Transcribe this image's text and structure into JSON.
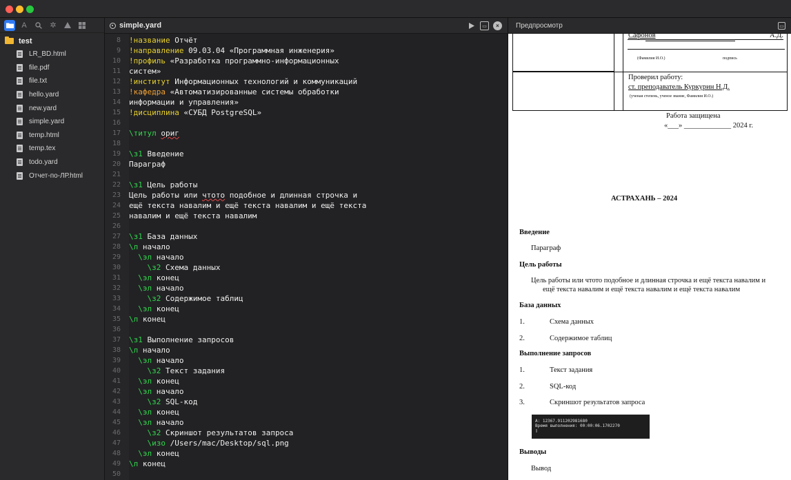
{
  "window": {
    "title_bar": ""
  },
  "sidebar": {
    "toolbar_icons": [
      "folder-icon",
      "text-icon",
      "search-icon",
      "gear-icon",
      "warning-icon",
      "grid-icon"
    ],
    "root": "test",
    "files": [
      "LR_BD.html",
      "file.pdf",
      "file.txt",
      "hello.yard",
      "new.yard",
      "simple.yard",
      "temp.html",
      "temp.tex",
      "todo.yard",
      "Отчет-по-ЛР.html"
    ]
  },
  "editor": {
    "tab": "simple.yard",
    "actions": [
      "run-icon",
      "save-icon",
      "close-icon"
    ],
    "lines": [
      {
        "n": "8",
        "parts": [
          [
            "kw",
            "!название"
          ],
          [
            "",
            " Отчёт"
          ]
        ]
      },
      {
        "n": "9",
        "parts": [
          [
            "kw",
            "!направление"
          ],
          [
            "",
            " 09.03.04 «Программная инженерия»"
          ]
        ]
      },
      {
        "n": "10",
        "parts": [
          [
            "kw",
            "!профиль"
          ],
          [
            "",
            " «Разработка программно-информационных"
          ]
        ]
      },
      {
        "n": "11",
        "parts": [
          [
            "",
            "систем»"
          ]
        ]
      },
      {
        "n": "12",
        "parts": [
          [
            "kw",
            "!институт"
          ],
          [
            "",
            " Информационных технологий и коммуникаций"
          ]
        ]
      },
      {
        "n": "13",
        "parts": [
          [
            "kwo",
            "!кафедра"
          ],
          [
            "",
            " «Автоматизированные системы обработки"
          ]
        ]
      },
      {
        "n": "14",
        "parts": [
          [
            "",
            "информации и управления»"
          ]
        ]
      },
      {
        "n": "15",
        "parts": [
          [
            "kw",
            "!дисциплина"
          ],
          [
            "",
            " «СУБД PostgreSQL»"
          ]
        ]
      },
      {
        "n": "16",
        "parts": []
      },
      {
        "n": "17",
        "parts": [
          [
            "cmd",
            "\\титул"
          ],
          [
            "",
            " "
          ],
          [
            "wavy",
            "ориг"
          ]
        ]
      },
      {
        "n": "18",
        "parts": []
      },
      {
        "n": "19",
        "parts": [
          [
            "cmd",
            "\\з1"
          ],
          [
            "",
            " Введение"
          ]
        ]
      },
      {
        "n": "20",
        "parts": [
          [
            "",
            "Параграф"
          ]
        ]
      },
      {
        "n": "21",
        "parts": []
      },
      {
        "n": "22",
        "parts": [
          [
            "cmd",
            "\\з1"
          ],
          [
            "",
            " Цель работы"
          ]
        ]
      },
      {
        "n": "23",
        "parts": [
          [
            "",
            "Цель работы или "
          ],
          [
            "wavy",
            "чтото"
          ],
          [
            "",
            " подобное и длинная строчка и"
          ]
        ]
      },
      {
        "n": "24",
        "parts": [
          [
            "",
            "ещё текста навалим и ещё текста навалим и ещё текста"
          ]
        ]
      },
      {
        "n": "25",
        "parts": [
          [
            "",
            "навалим и ещё текста навалим"
          ]
        ]
      },
      {
        "n": "26",
        "parts": []
      },
      {
        "n": "27",
        "parts": [
          [
            "cmd",
            "\\з1"
          ],
          [
            "",
            " База данных"
          ]
        ]
      },
      {
        "n": "28",
        "parts": [
          [
            "cmd",
            "\\л"
          ],
          [
            "",
            " начало"
          ]
        ]
      },
      {
        "n": "29",
        "parts": [
          [
            "",
            "  "
          ],
          [
            "cmd",
            "\\эл"
          ],
          [
            "",
            " начало"
          ]
        ]
      },
      {
        "n": "30",
        "parts": [
          [
            "",
            "    "
          ],
          [
            "cmd",
            "\\з2"
          ],
          [
            "",
            " Схема данных"
          ]
        ]
      },
      {
        "n": "31",
        "parts": [
          [
            "",
            "  "
          ],
          [
            "cmd",
            "\\эл"
          ],
          [
            "",
            " конец"
          ]
        ]
      },
      {
        "n": "32",
        "parts": [
          [
            "",
            "  "
          ],
          [
            "cmd",
            "\\эл"
          ],
          [
            "",
            " начало"
          ]
        ]
      },
      {
        "n": "33",
        "parts": [
          [
            "",
            "    "
          ],
          [
            "cmd",
            "\\з2"
          ],
          [
            "",
            " Содержимое таблиц"
          ]
        ]
      },
      {
        "n": "34",
        "parts": [
          [
            "",
            "  "
          ],
          [
            "cmd",
            "\\эл"
          ],
          [
            "",
            " конец"
          ]
        ]
      },
      {
        "n": "35",
        "parts": [
          [
            "cmd",
            "\\л"
          ],
          [
            "",
            " конец"
          ]
        ]
      },
      {
        "n": "36",
        "parts": []
      },
      {
        "n": "37",
        "parts": [
          [
            "cmd",
            "\\з1"
          ],
          [
            "",
            " Выполнение запросов"
          ]
        ]
      },
      {
        "n": "38",
        "parts": [
          [
            "cmd",
            "\\л"
          ],
          [
            "",
            " начало"
          ]
        ]
      },
      {
        "n": "39",
        "parts": [
          [
            "",
            "  "
          ],
          [
            "cmd",
            "\\эл"
          ],
          [
            "",
            " начало"
          ]
        ]
      },
      {
        "n": "40",
        "parts": [
          [
            "",
            "    "
          ],
          [
            "cmd",
            "\\з2"
          ],
          [
            "",
            " Текст задания"
          ]
        ]
      },
      {
        "n": "41",
        "parts": [
          [
            "",
            "  "
          ],
          [
            "cmd",
            "\\эл"
          ],
          [
            "",
            " конец"
          ]
        ]
      },
      {
        "n": "42",
        "parts": [
          [
            "",
            "  "
          ],
          [
            "cmd",
            "\\эл"
          ],
          [
            "",
            " начало"
          ]
        ]
      },
      {
        "n": "43",
        "parts": [
          [
            "",
            "    "
          ],
          [
            "cmd",
            "\\з2"
          ],
          [
            "",
            " SQL-код"
          ]
        ]
      },
      {
        "n": "44",
        "parts": [
          [
            "",
            "  "
          ],
          [
            "cmd",
            "\\эл"
          ],
          [
            "",
            " конец"
          ]
        ]
      },
      {
        "n": "45",
        "parts": [
          [
            "",
            "  "
          ],
          [
            "cmd",
            "\\эл"
          ],
          [
            "",
            " начало"
          ]
        ]
      },
      {
        "n": "46",
        "parts": [
          [
            "",
            "    "
          ],
          [
            "cmd",
            "\\з2"
          ],
          [
            "",
            " Скриншот результатов запроса"
          ]
        ]
      },
      {
        "n": "47",
        "parts": [
          [
            "",
            "    "
          ],
          [
            "cmd",
            "\\изо"
          ],
          [
            "",
            " /Users/mac/Desktop/sql.png"
          ]
        ]
      },
      {
        "n": "48",
        "parts": [
          [
            "",
            "  "
          ],
          [
            "cmd",
            "\\эл"
          ],
          [
            "",
            " конец"
          ]
        ]
      },
      {
        "n": "49",
        "parts": [
          [
            "cmd",
            "\\л"
          ],
          [
            "",
            " конец"
          ]
        ]
      },
      {
        "n": "50",
        "parts": []
      }
    ]
  },
  "preview": {
    "title": "Предпросмотр",
    "sig": {
      "name": "Сафонов",
      "initials": "А.Д.",
      "fio_caption": "(Фамилия И.О.)",
      "sign_caption": "подпись",
      "checked": "Проверил работу:",
      "teacher": "ст. преподаватель Куркурин Н.Д.",
      "teacher_caption": "(ученая степень, ученое звание, Фамилия И.О.)"
    },
    "defended": "Работа защищена",
    "date_line": "«___» _____________ 2024 г.",
    "city": "АСТРАХАНЬ – 2024",
    "sections": {
      "intro_h": "Введение",
      "intro_p": "Параграф",
      "goal_h": "Цель работы",
      "goal_p1": "Цель работы или чтото подобное и длинная строчка и ещё текста навалим и",
      "goal_p2": "ещё текста навалим и ещё текста навалим и ещё текста навалим",
      "db_h": "База данных",
      "db_items": [
        [
          "1.",
          "Схема данных"
        ],
        [
          "2.",
          "Содержимое таблиц"
        ]
      ],
      "q_h": "Выполнение запросов",
      "q_items": [
        [
          "1.",
          "Текст задания"
        ],
        [
          "2.",
          "SQL-код"
        ],
        [
          "3.",
          "Скриншот результатов запроса"
        ]
      ],
      "shot_l1": "A: 12367.911202981680",
      "shot_l2": "Время выполнения: 00:00:06.1702270",
      "shot_l3": "▯",
      "concl_h": "Выводы",
      "concl_p": "Вывод"
    }
  }
}
